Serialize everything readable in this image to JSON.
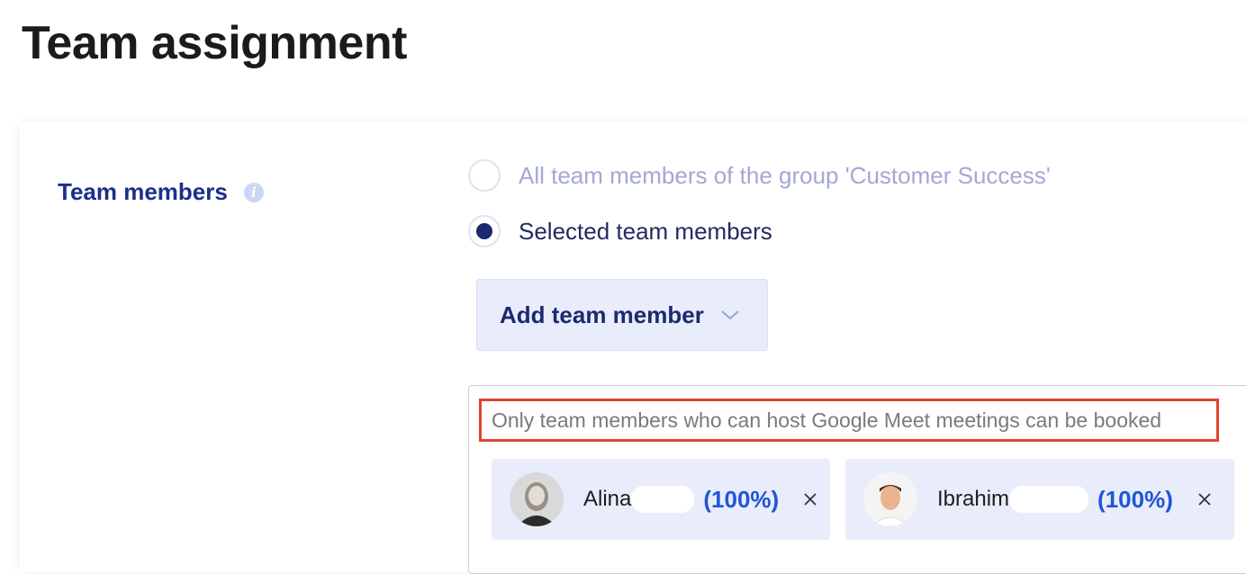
{
  "page": {
    "title": "Team assignment"
  },
  "team_members": {
    "label": "Team members",
    "info_icon": "info-icon",
    "options": [
      {
        "label": "All team members of the group 'Customer Success'",
        "selected": false
      },
      {
        "label": "Selected team members",
        "selected": true
      }
    ],
    "add_button": {
      "label": "Add team member",
      "icon": "chevron-down-icon"
    },
    "notice": "Only team members who can host Google Meet meetings can be booked",
    "members": [
      {
        "name": "Alina",
        "share": "(100%)"
      },
      {
        "name": "Ibrahim",
        "share": "(100%)"
      }
    ]
  },
  "colors": {
    "accent": "#1b2a6e",
    "link": "#2055d8",
    "highlight": "#e2442c",
    "chip_bg": "#e9edfb"
  }
}
